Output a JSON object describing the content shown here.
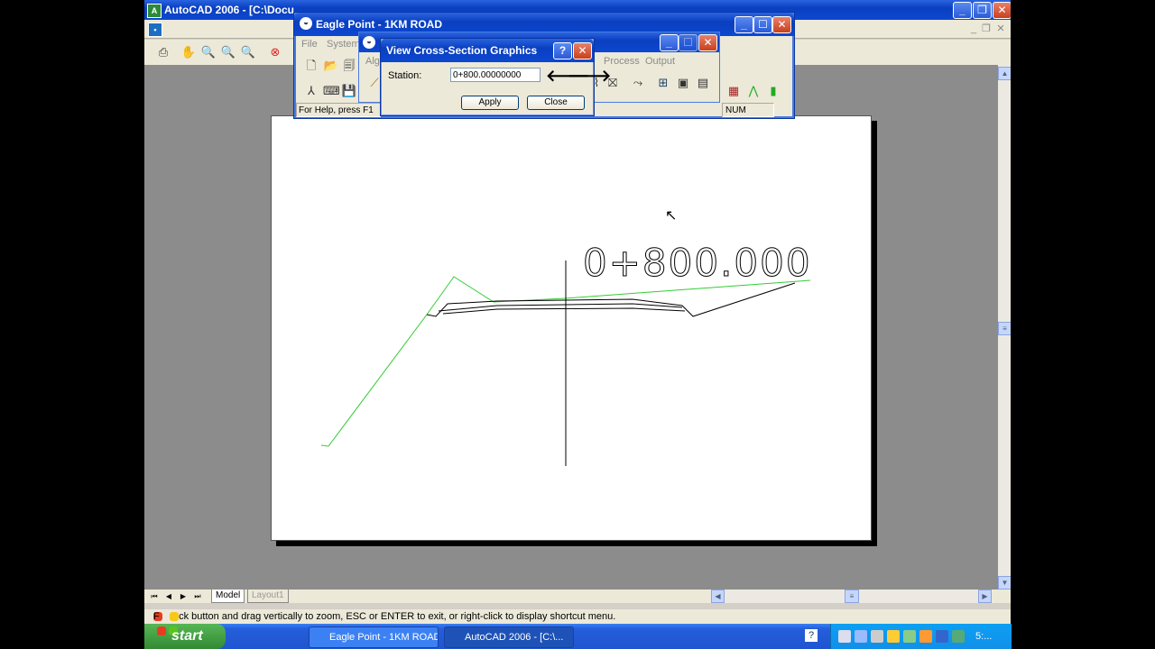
{
  "acad": {
    "title": "AutoCAD 2006 - [C:\\Docu...",
    "min": "_",
    "max": "❐",
    "close": "✕"
  },
  "eagle": {
    "title": "Eagle Point - 1KM ROAD",
    "menu": [
      "File",
      "System"
    ],
    "status_left": "For Help, press F1",
    "status_num": "NUM"
  },
  "secondary": {
    "menu_partial": "Alg",
    "menu": [
      "Process",
      "Output"
    ]
  },
  "dialog": {
    "title": "View Cross-Section Graphics",
    "help": "?",
    "close_x": "✕",
    "station_label": "Station:",
    "station_value": "0+800.00000000",
    "prev_arrow": "🡐",
    "next_arrow": "🡒",
    "apply": "Apply",
    "close": "Close"
  },
  "drawing": {
    "station_text": "0+800.000",
    "ground_color": "#33cc33",
    "design_color": "#000000"
  },
  "layout": {
    "tabs": [
      "Model",
      "Layout1"
    ]
  },
  "status": {
    "prompt": "F       ck button and drag vertically to zoom, ESC or ENTER to exit, or right-click to display shortcut menu."
  },
  "taskbar": {
    "start": "start",
    "tasks": [
      "Eagle Point - 1KM ROAD",
      "AutoCAD 2006 - [C:\\..."
    ],
    "clock": "5:..."
  }
}
